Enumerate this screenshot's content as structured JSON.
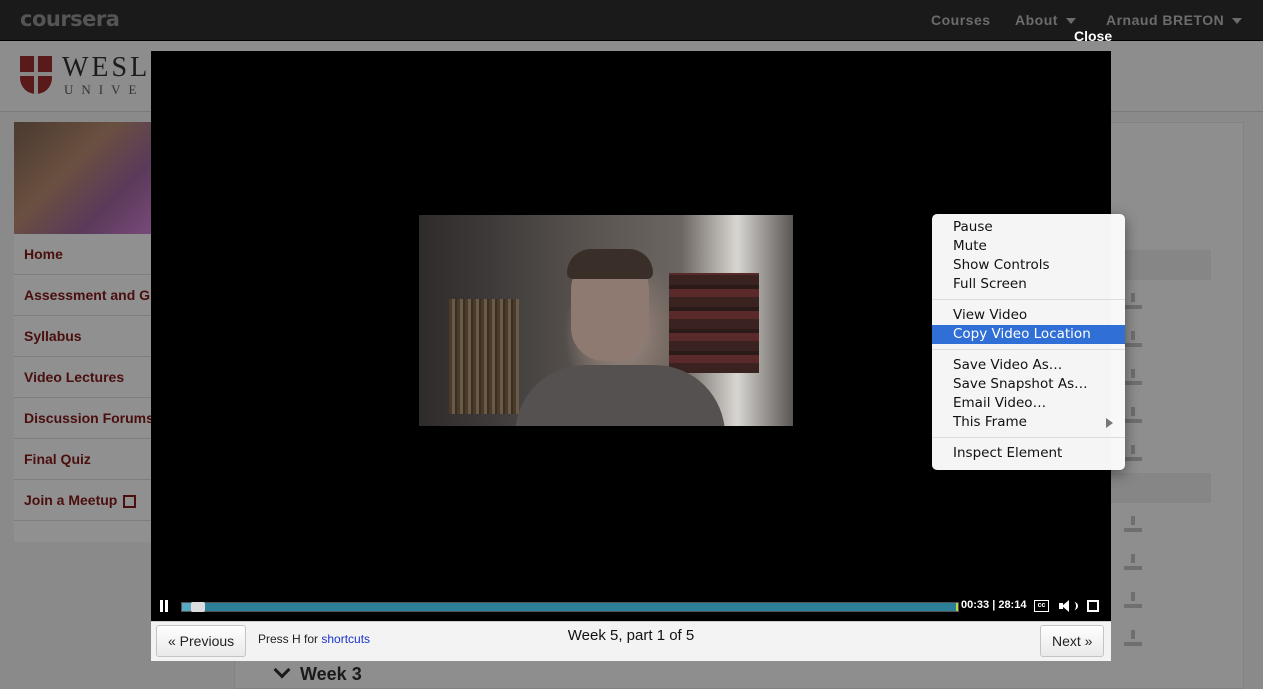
{
  "app": {
    "logo": "coursera",
    "nav": {
      "courses": "Courses",
      "about": "About",
      "user": "Arnaud BRETON"
    }
  },
  "university": {
    "name": "WESLE",
    "subtitle": "UNIVE"
  },
  "sidebar": {
    "items": [
      {
        "label": "Home"
      },
      {
        "label": "Assessment and Gr"
      },
      {
        "label": "Syllabus"
      },
      {
        "label": "Video Lectures"
      },
      {
        "label": "Discussion Forums"
      },
      {
        "label": "Final Quiz"
      },
      {
        "label": "Join a Meetup"
      }
    ]
  },
  "background": {
    "week_heading": "Week 3"
  },
  "modal": {
    "close_label": "Close"
  },
  "player": {
    "current_time": "00:33",
    "duration": "28:14",
    "time_display": "00:33 | 28:14",
    "played_fraction": 0.02,
    "cc_label": "cc"
  },
  "lecture_nav": {
    "previous_label": "« Previous",
    "next_label": "Next »",
    "shortcut_prefix": "Press H for ",
    "shortcut_link": "shortcuts",
    "title": "Week 5, part 1 of 5"
  },
  "context_menu": {
    "groups": [
      [
        "Pause",
        "Mute",
        "Show Controls",
        "Full Screen"
      ],
      [
        "View Video",
        "Copy Video Location"
      ],
      [
        "Save Video As…",
        "Save Snapshot As…",
        "Email Video…",
        "This Frame"
      ],
      [
        "Inspect Element"
      ]
    ],
    "highlighted": "Copy Video Location"
  },
  "colors": {
    "menu_highlight": "#2f6fd6",
    "progress": "#2c7f98",
    "sidebar_text": "#4a0e0e"
  }
}
